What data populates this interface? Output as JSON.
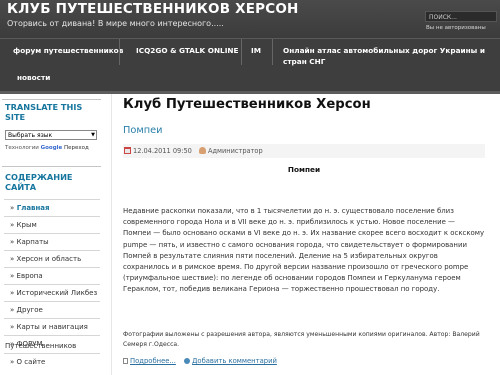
{
  "header": {
    "site_title": "КЛУБ ПУТЕШЕСТВЕННИКОВ ХЕРСОН",
    "site_description": "Оторвись от дивана! В мире много интересного.....",
    "search_placeholder": "ПОИСК...",
    "auth_status": "Вы не авторизованы"
  },
  "nav": {
    "items": [
      {
        "label": "форум путешественников"
      },
      {
        "label": "ICQ2GO & GTALK ONLINE"
      },
      {
        "label": "IM"
      },
      {
        "label": "Онлайн атлас автомобильных дорог Украины и стран СНГ"
      },
      {
        "label": "новости"
      }
    ]
  },
  "sidebar": {
    "translate_title": "TRANSLATE THIS SITE",
    "language_select": "Выбрать язык",
    "powered_prefix": "Технологии",
    "powered_google": "Google",
    "powered_suffix": "Переход",
    "contents_title": "СОДЕРЖАНИЕ САЙТА",
    "menu": [
      {
        "label": "Главная",
        "active": true
      },
      {
        "label": "Крым"
      },
      {
        "label": "Карпаты"
      },
      {
        "label": "Херсон и область"
      },
      {
        "label": "Европа"
      },
      {
        "label": "Исторический Ликбез"
      },
      {
        "label": "Другое"
      },
      {
        "label": "Карты и навигация"
      },
      {
        "label": "ФОРУМ"
      }
    ],
    "section2_title": "Путешественников",
    "menu2": [
      {
        "label": "О сайте"
      }
    ],
    "bullet": "»"
  },
  "main": {
    "page_title": "Клуб Путешественников Херсон",
    "article_title": "Помпеи",
    "date": "12.04.2011 09:50",
    "author": "Администратор",
    "heading": "Помпеи",
    "body": "Недавние раскопки показали, что в 1 тысячелетии до н. э. существовало поселение близ современного города Нола и в VII веке до н. э. приблизилось к устью. Новое поселение — Помпеи — было основано осками в VI веке до н. э. Их название скорее всего восходит к оскскому pumpe — пять, и известно с самого основания города, что свидетельствует о формировании Помпей в результате слияния пяти поселений. Деление на 5 избирательных округов сохранилось и в римское время. По другой версии название произошло от греческого pompe (триумфальное шествие): по легенде об основании городов Помпеи и Геркуланума героем Гераклом, тот, победив великана Гериона — торжественно прошествовал по городу.",
    "footnote": "Фотографии выложены с разрешения автора, являются уменьшенными копиями оригиналов. Автор: Валерий Семеря г.Одесса.",
    "more_link": "Подробнее...",
    "comment_link": "Добавить комментарий"
  },
  "colors": {
    "accent": "#17769e",
    "link": "#2a7fa8",
    "header_bg": "#444444"
  }
}
